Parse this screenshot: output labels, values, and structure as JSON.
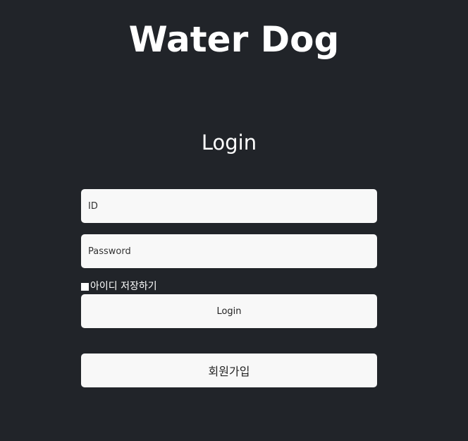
{
  "app": {
    "title": "Water Dog"
  },
  "login_form": {
    "heading": "Login",
    "id_placeholder": "ID",
    "password_placeholder": "Password",
    "remember_label": "아이디 저장하기",
    "remember_checked": false,
    "login_button_label": "Login",
    "signup_button_label": "회원가입"
  },
  "colors": {
    "background": "#212429",
    "field_background": "#f8f8f8",
    "text": "#ffffff"
  }
}
